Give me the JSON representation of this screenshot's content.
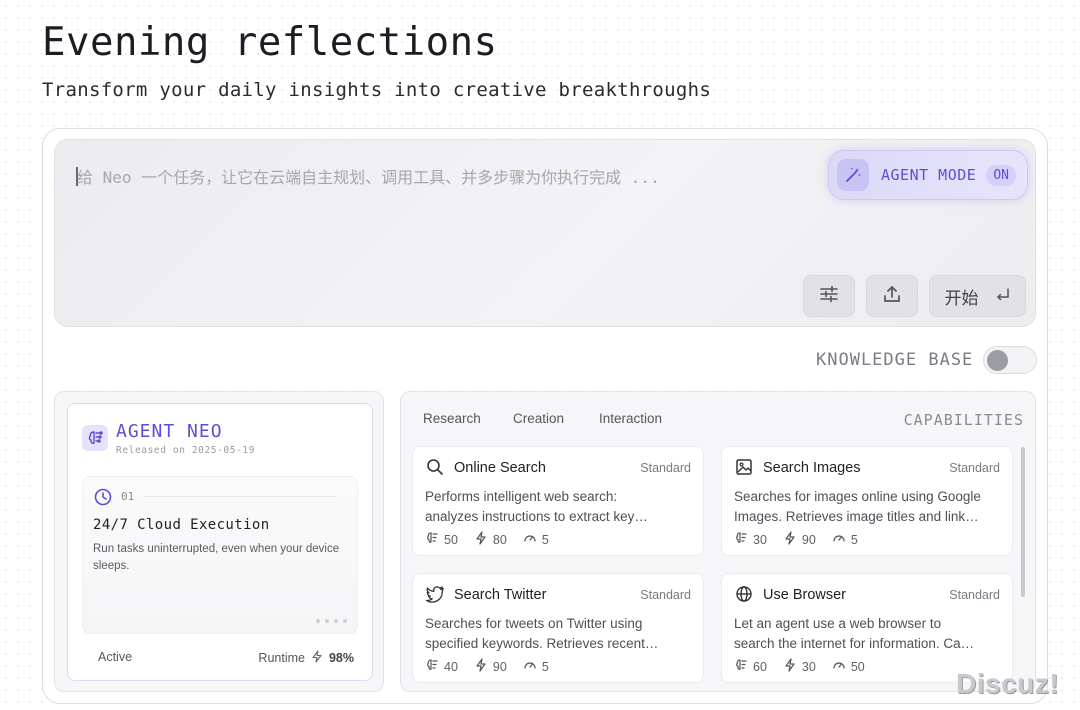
{
  "header": {
    "title": "Evening reflections",
    "subtitle": "Transform your daily insights into creative breakthroughs"
  },
  "task": {
    "placeholder": "给 Neo 一个任务，让它在云端自主规划、调用工具、并多步骤为你执行完成 ...",
    "agent_mode_label": "AGENT MODE",
    "agent_mode_state": "ON",
    "start_label": "开始"
  },
  "knowledge_base": {
    "label": "KNOWLEDGE BASE",
    "enabled": false
  },
  "agent": {
    "name": "AGENT NEO",
    "released": "Released on 2025-05-19",
    "feature_num": "01",
    "feature_title": "24/7 Cloud Execution",
    "feature_desc": "Run tasks uninterrupted, even when your device sleeps.",
    "status": "Active",
    "runtime_label": "Runtime",
    "runtime_value": "98%"
  },
  "capabilities": {
    "title": "CAPABILITIES",
    "tabs": [
      "Research",
      "Creation",
      "Interaction"
    ],
    "cards": [
      {
        "name": "Online Search",
        "tier": "Standard",
        "icon": "search-icon",
        "desc_line1": "Performs intelligent web search:",
        "desc_line2": "analyzes instructions to extract key…",
        "stat1": "50",
        "stat2": "80",
        "stat3": "5"
      },
      {
        "name": "Search Images",
        "tier": "Standard",
        "icon": "image-icon",
        "desc_line1": "Searches for images online using Google",
        "desc_line2": "Images. Retrieves image titles and link…",
        "stat1": "30",
        "stat2": "90",
        "stat3": "5"
      },
      {
        "name": "Search Twitter",
        "tier": "Standard",
        "icon": "twitter-icon",
        "desc_line1": "Searches for tweets on Twitter using",
        "desc_line2": "specified keywords. Retrieves recent…",
        "stat1": "40",
        "stat2": "90",
        "stat3": "5"
      },
      {
        "name": "Use Browser",
        "tier": "Standard",
        "icon": "globe-icon",
        "desc_line1": "Let an agent use a web browser to",
        "desc_line2": "search the internet for information. Ca…",
        "stat1": "60",
        "stat2": "30",
        "stat3": "50"
      }
    ]
  },
  "watermark": "Discuz!"
}
